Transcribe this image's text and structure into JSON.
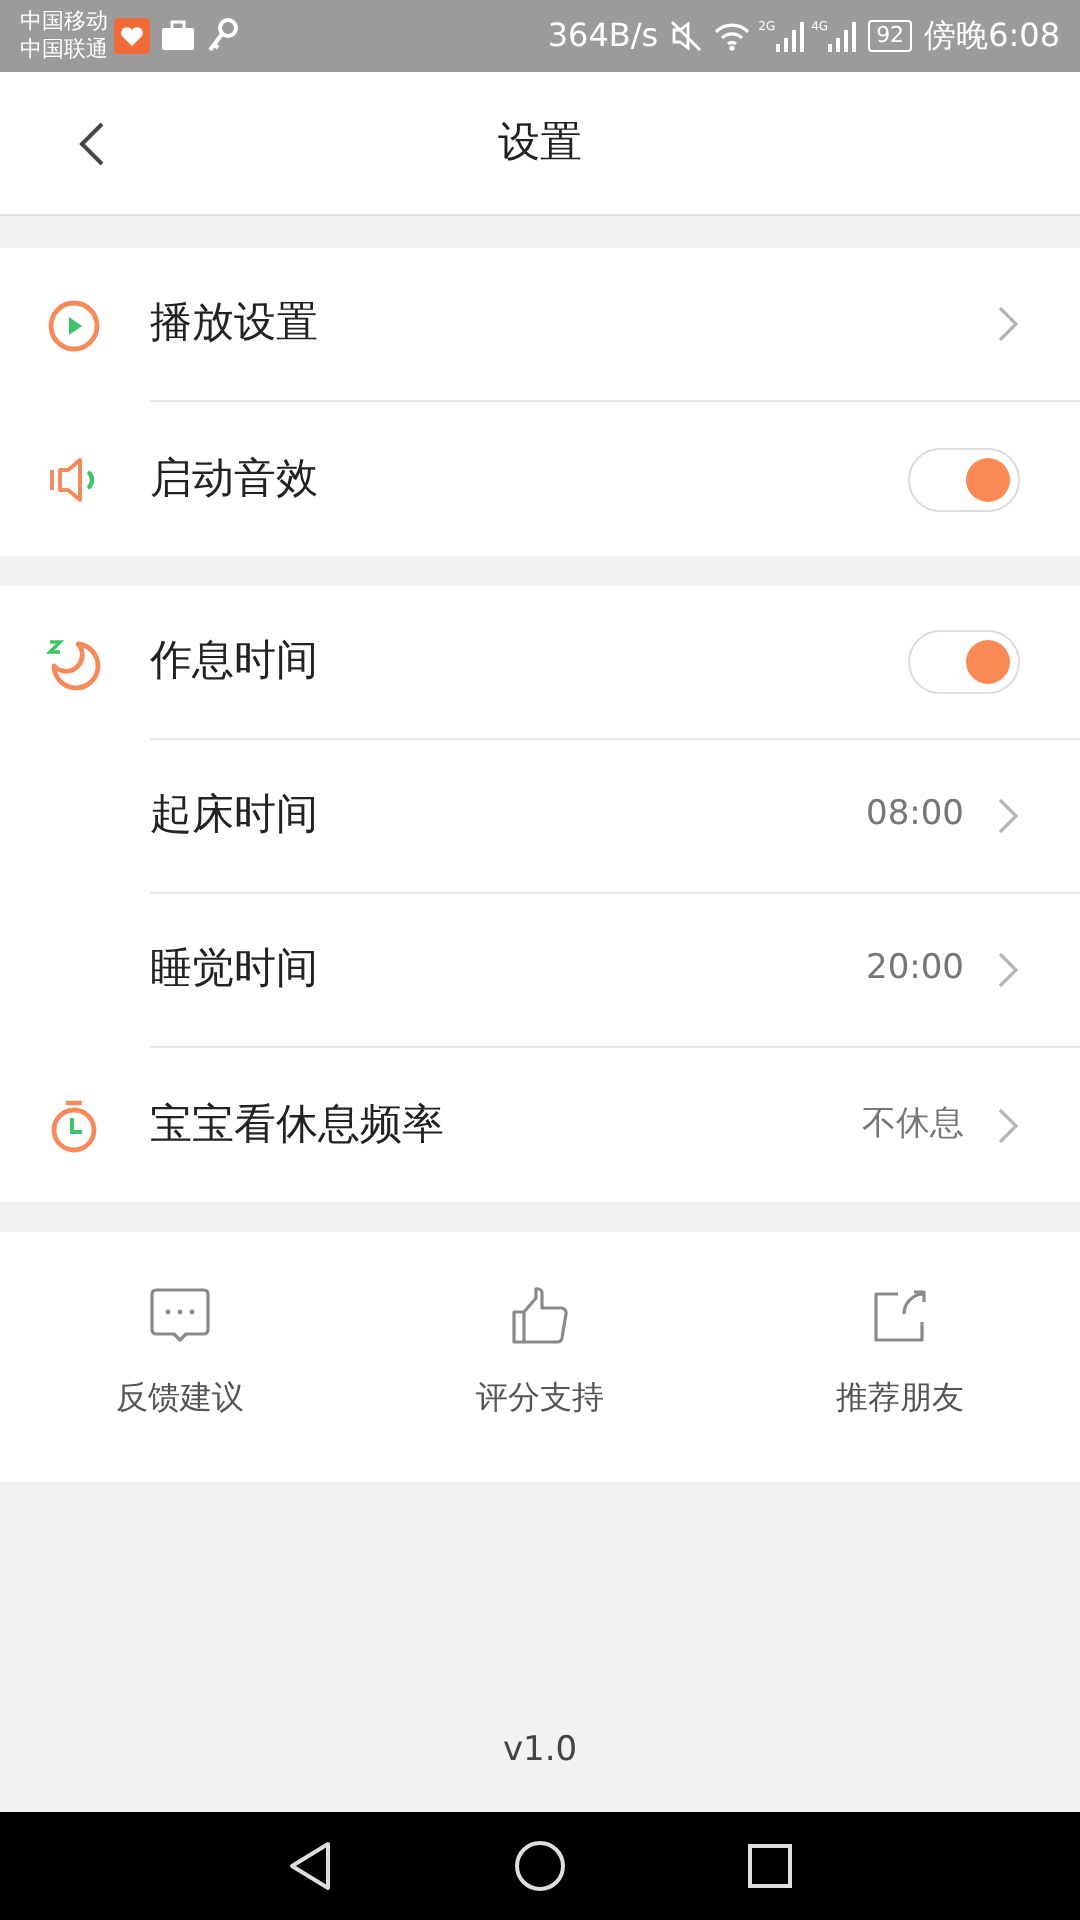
{
  "status_bar": {
    "carriers": [
      "中国移动",
      "中国联通"
    ],
    "speed": "364B/s",
    "networks": [
      "2G",
      "4G"
    ],
    "battery": "92",
    "time": "傍晚6:08"
  },
  "header": {
    "title": "设置"
  },
  "sections": [
    [
      {
        "label": "播放设置",
        "kind": "link"
      },
      {
        "label": "启动音效",
        "kind": "toggle",
        "on": true
      }
    ],
    [
      {
        "label": "作息时间",
        "kind": "toggle",
        "on": true
      },
      {
        "label": "起床时间",
        "kind": "link",
        "value": "08:00"
      },
      {
        "label": "睡觉时间",
        "kind": "link",
        "value": "20:00"
      },
      {
        "label": "宝宝看休息频率",
        "kind": "link",
        "value": "不休息"
      }
    ]
  ],
  "actions": [
    {
      "label": "反馈建议"
    },
    {
      "label": "评分支持"
    },
    {
      "label": "推荐朋友"
    }
  ],
  "version": "v1.0"
}
